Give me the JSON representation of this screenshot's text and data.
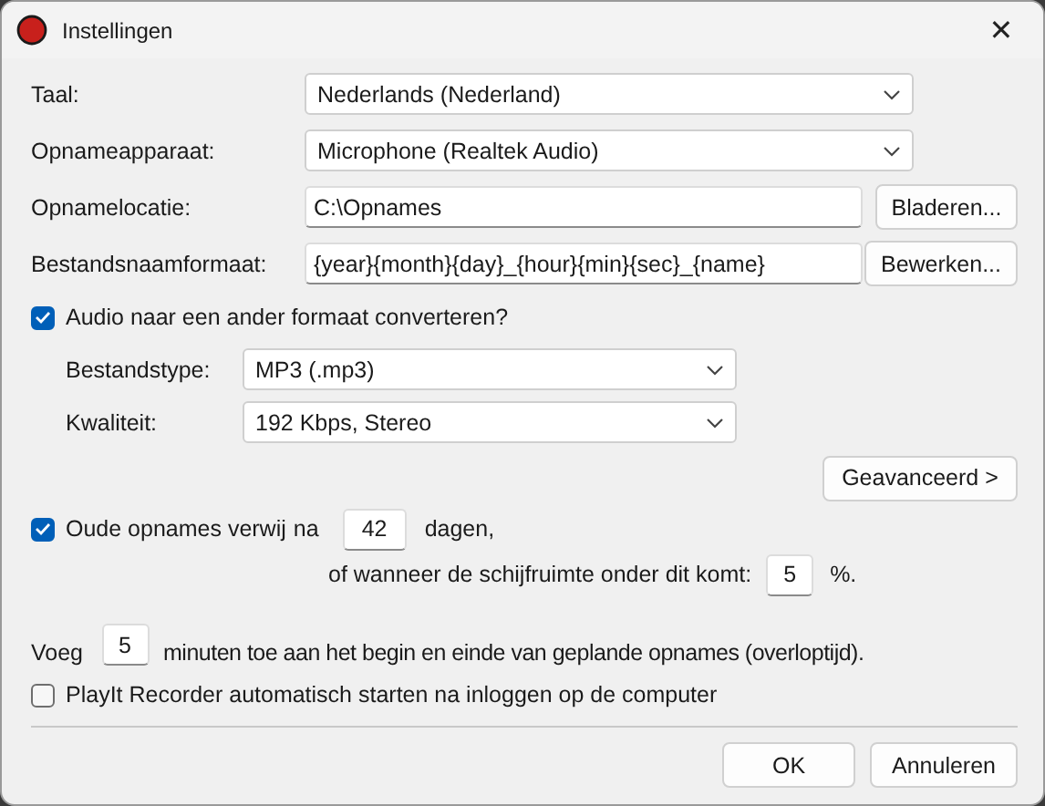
{
  "window": {
    "title": "Instellingen",
    "close": "✕"
  },
  "fields": [
    {
      "kind": "select",
      "label": "Taal:",
      "value": "Nederlands (Nederland)"
    },
    {
      "kind": "select",
      "label": "Opnameapparaat:",
      "value": "Microphone (Realtek Audio)"
    },
    {
      "kind": "text",
      "label": "Opnamelocatie:",
      "value": "C:\\Opnames",
      "button": "Bladeren..."
    },
    {
      "kind": "text",
      "label": "Bestandsnaamformaat:",
      "value": "{year}{month}{day}_{hour}{min}{sec}_{name}",
      "button": "Bewerken..."
    }
  ],
  "convert": {
    "label": "Audio naar een ander formaat converteren?",
    "checked": true,
    "fields": [
      {
        "label": "Bestandstype:",
        "value": "MP3 (.mp3)"
      },
      {
        "label": "Kwaliteit:",
        "value": "192 Kbps, Stereo"
      }
    ],
    "advanced_button": "Geavanceerd >"
  },
  "cleanup": {
    "label": "Oude opnames verwij",
    "checked": true,
    "after": "na",
    "days": "42",
    "days_unit": "dagen,",
    "disk_label": "of wanneer de schijfruimte onder dit komt:",
    "disk_value": "5",
    "disk_unit": "%."
  },
  "padding": {
    "before": "Voeg",
    "value": "5",
    "after": "minuten toe aan het begin en einde van geplande opnames (overloptijd)."
  },
  "autostart": {
    "label": "PlayIt Recorder automatisch starten na inloggen op de computer",
    "checked": false
  },
  "buttons": [
    "OK",
    "Annuleren"
  ]
}
